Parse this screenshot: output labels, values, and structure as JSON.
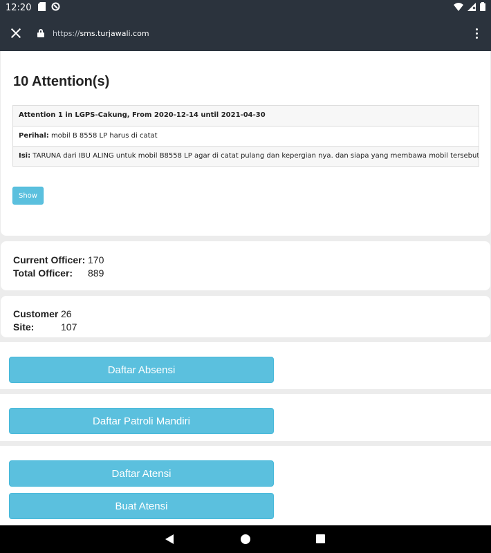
{
  "status_bar": {
    "time": "12:20"
  },
  "browser": {
    "url_prefix": "https://",
    "url_host": "sms.turjawali.com"
  },
  "attention": {
    "title": "10 Attention(s)",
    "header": "Attention 1 in LGPS-Cakung, From 2020-12-14 until 2021-04-30",
    "perihal_label": "Perihal:",
    "perihal_value": " mobil B 8558 LP harus di catat",
    "isi_label": "Isi:",
    "isi_value": " TARUNA dari IBU ALING untuk mobil B8558 LP agar di catat pulang dan kepergian nya. dan siapa yang membawa mobil tersebut.",
    "show_label": "Show"
  },
  "officers": {
    "current_label": "Current Officer:",
    "current_value": "170",
    "total_label": "Total Officer:",
    "total_value": "889"
  },
  "customers": {
    "customer_label": "Customer",
    "customer_value": "26",
    "site_label": "Site:",
    "site_value": "107"
  },
  "buttons": {
    "daftar_absensi": "Daftar Absensi",
    "daftar_patroli": "Daftar Patroli Mandiri",
    "daftar_atensi": "Daftar Atensi",
    "buat_atensi": "Buat Atensi"
  },
  "colors": {
    "button": "#5bc0de",
    "topbar": "#2b333d"
  }
}
